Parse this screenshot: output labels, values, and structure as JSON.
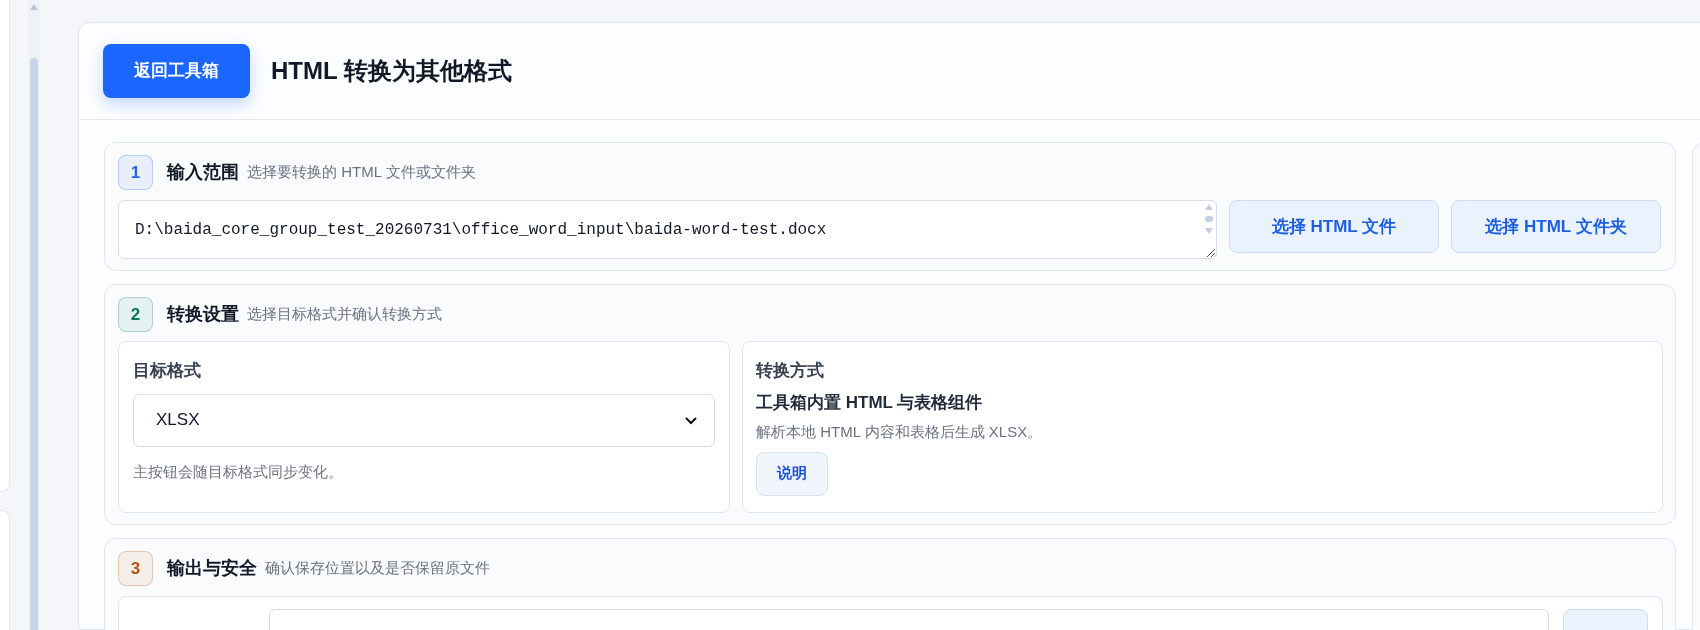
{
  "header": {
    "back_button": "返回工具箱",
    "title": "HTML 转换为其他格式"
  },
  "sections": [
    {
      "kind": "input",
      "number": "1",
      "color": "#2563eb",
      "title": "输入范围",
      "description": "选择要转换的 HTML 文件或文件夹",
      "path_value": "D:\\baida_core_group_test_20260731\\office_word_input\\baida-word-test.docx",
      "buttons": [
        "选择 HTML 文件",
        "选择 HTML 文件夹"
      ]
    },
    {
      "kind": "settings",
      "number": "2",
      "color": "#047857",
      "title": "转换设置",
      "description": "选择目标格式并确认转换方式",
      "format_label": "目标格式",
      "format_value": "XLSX",
      "format_hint": "主按钮会随目标格式同步变化。",
      "method_label": "转换方式",
      "method_title": "工具箱内置 HTML 与表格组件",
      "method_description": "解析本地 HTML 内容和表格后生成 XLSX。",
      "method_button": "说明"
    },
    {
      "kind": "output",
      "number": "3",
      "color": "#b45309",
      "title": "输出与安全",
      "description": "确认保存位置以及是否保留原文件"
    }
  ]
}
